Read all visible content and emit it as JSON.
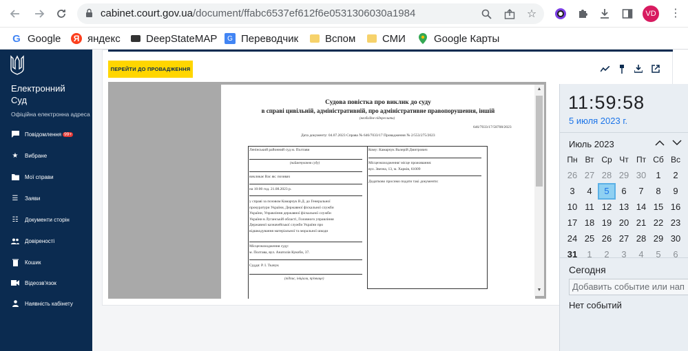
{
  "browser": {
    "url_domain": "cabinet.court.gov.ua",
    "url_path": "/document/ffabc6537ef612f6e0531306030a1984",
    "avatar": "VD"
  },
  "bookmarks": [
    {
      "label": "Google",
      "icon": "google-icon",
      "color": "#4285f4"
    },
    {
      "label": "яндекс",
      "icon": "yandex-icon",
      "color": "#fc3f1d"
    },
    {
      "label": "DeepStateMAP",
      "icon": "deepstate-icon",
      "color": "#333333"
    },
    {
      "label": "Переводчик",
      "icon": "translate-icon",
      "color": "#4285f4"
    },
    {
      "label": "Вспом",
      "icon": "folder-icon",
      "color": "#f6d26b"
    },
    {
      "label": "СМИ",
      "icon": "folder-icon",
      "color": "#f6d26b"
    },
    {
      "label": "Google Карты",
      "icon": "maps-icon",
      "color": "#34a853"
    }
  ],
  "sidebar": {
    "brand_line1": "Електронний",
    "brand_line2": "Суд",
    "brand_sub": "Офіційна електронна адреса",
    "items": [
      {
        "label": "Повідомлення",
        "badge": "99+",
        "icon": "message-icon"
      },
      {
        "label": "Вибране",
        "icon": "star-icon"
      },
      {
        "label": "Мої справи",
        "icon": "folder-icon"
      },
      {
        "label": "Заяви",
        "icon": "list-icon"
      },
      {
        "label": "Документи сторін",
        "icon": "checklist-icon"
      },
      {
        "label": "Довіреності",
        "icon": "people-icon"
      },
      {
        "label": "Кошик",
        "icon": "trash-icon"
      },
      {
        "label": "Відеозв'язок",
        "icon": "video-icon"
      },
      {
        "label": "Наявність кабінету",
        "icon": "person-icon"
      }
    ]
  },
  "toolbar": {
    "goto_label": "ПЕРЕЙТИ ДО ПРОВАДЖЕННЯ"
  },
  "document": {
    "title": "Судова повістка про виклик до суду",
    "subtitle": "в справі цивільній, адміністративній, про адміністративне правопорушення, іншій",
    "subtitle_note": "(необхідне підкреслити)",
    "case_no": "646/7033/17/58708/2023",
    "meta": "Дата документу: 04.07.2023 Справа № 646/7033/17 Провадження № 2/553/275/2023",
    "court": "Ленінський районний суд м. Полтави",
    "court_note": "(найменування суду)",
    "summons": "викликає Вас як: позивач",
    "time": "на 10:00 год. 21.08.2023 р.",
    "case_text": [
      "у справі за позовом Камарчук В.Д. до Генеральної",
      "прокуратури України, Державної фіскальної служби",
      "України, Управління державної фіскальної служби",
      "України в Луганській області, Головного управління",
      "Державної казначейської служби України про",
      "відшкодування матеріальної та моральної шкоди"
    ],
    "location_label": "Місцезнаходження суду:",
    "location": "м. Полтава, вул. Анатолія Кукоби, 37.",
    "judge": "Суддя: Р. І. Ткачук",
    "judge_note": "(підпис, ініціали, прізвище)",
    "to": "Кому: Камарчук Валерій Дмитрович",
    "to_address_label": "Місцезнаходження/ місце проживання:",
    "to_address": "вул. Звезна, 13, м. Харків, 61009",
    "to_docs": "Додатково просимо подати такі документи:"
  },
  "calendar": {
    "time": "11:59:58",
    "date": "5 июля 2023 г.",
    "month_label": "Июль 2023",
    "weekdays": [
      "Пн",
      "Вт",
      "Ср",
      "Чт",
      "Пт",
      "Сб",
      "Вс"
    ],
    "weeks": [
      [
        "26",
        "27",
        "28",
        "29",
        "30",
        "1",
        "2"
      ],
      [
        "3",
        "4",
        "5",
        "6",
        "7",
        "8",
        "9"
      ],
      [
        "10",
        "11",
        "12",
        "13",
        "14",
        "15",
        "16"
      ],
      [
        "17",
        "18",
        "19",
        "20",
        "21",
        "22",
        "23"
      ],
      [
        "24",
        "25",
        "26",
        "27",
        "28",
        "29",
        "30"
      ],
      [
        "31",
        "1",
        "2",
        "3",
        "4",
        "5",
        "6"
      ]
    ],
    "today_label": "Сегодня",
    "add_placeholder": "Добавить событие или нап",
    "no_events": "Нет событий"
  }
}
